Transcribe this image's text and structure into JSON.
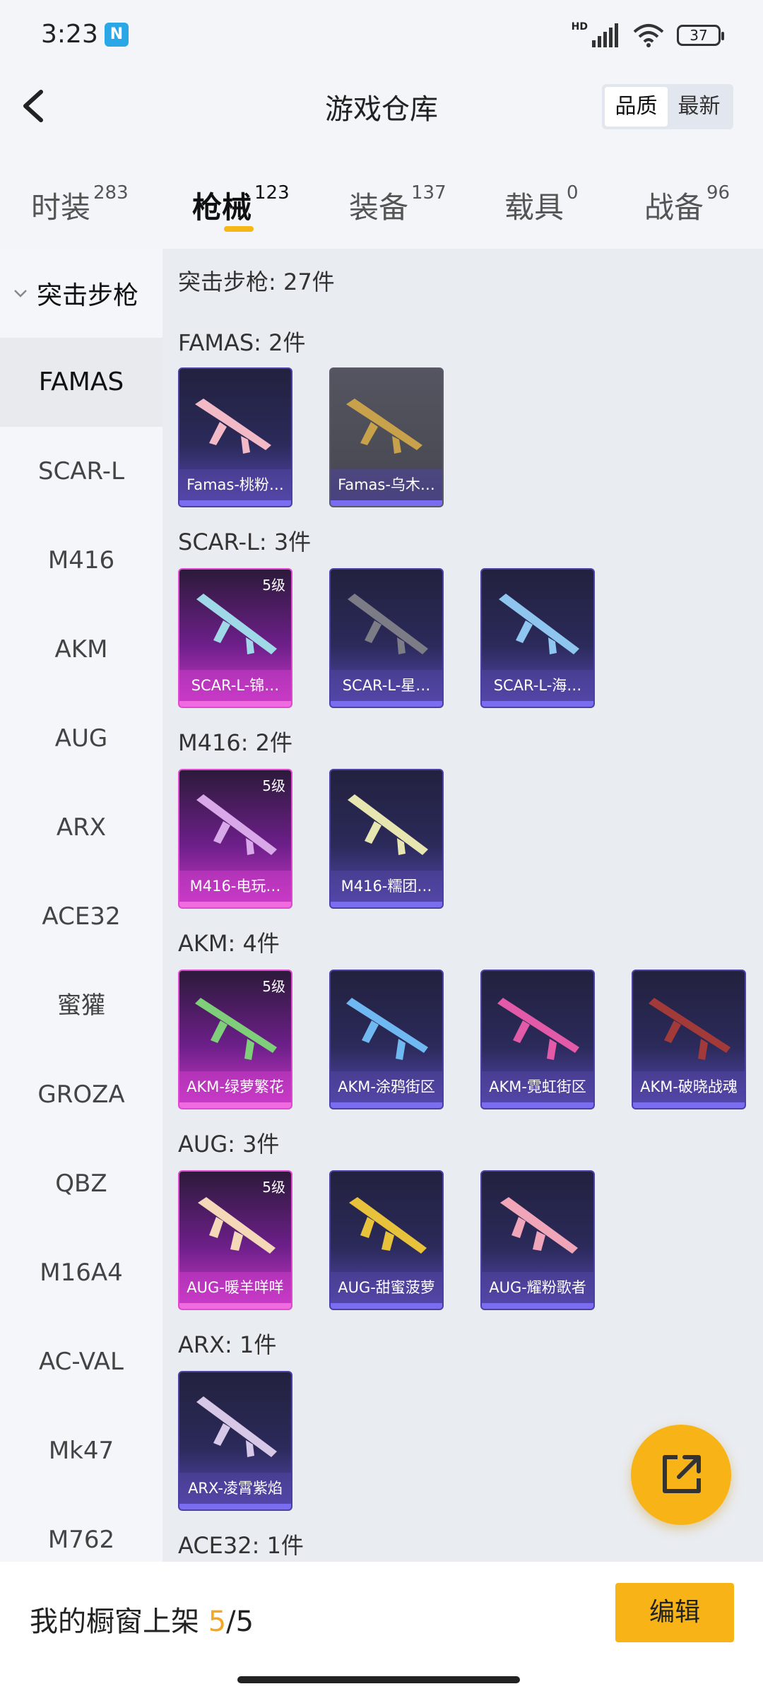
{
  "status": {
    "time": "3:23",
    "battery": "37",
    "hd_label": "HD"
  },
  "header": {
    "title": "游戏仓库",
    "sort_options": [
      "品质",
      "最新"
    ],
    "sort_active": "品质"
  },
  "tabs": [
    {
      "label": "时装",
      "count": "283"
    },
    {
      "label": "枪械",
      "count": "123"
    },
    {
      "label": "装备",
      "count": "137"
    },
    {
      "label": "载具",
      "count": "0"
    },
    {
      "label": "战备",
      "count": "96"
    }
  ],
  "sidebar": {
    "group": "突击步枪",
    "items": [
      "FAMAS",
      "SCAR-L",
      "M416",
      "AKM",
      "AUG",
      "ARX",
      "ACE32",
      "蜜獾",
      "GROZA",
      "QBZ",
      "M16A4",
      "AC-VAL",
      "Mk47",
      "M762"
    ]
  },
  "content": {
    "summary": "突击步枪: 27件",
    "groups": [
      {
        "title": "FAMAS: 2件",
        "items": [
          {
            "name": "Famas-桃粉…",
            "grade": ""
          },
          {
            "name": "Famas-乌木…",
            "grade": ""
          }
        ]
      },
      {
        "title": "SCAR-L: 3件",
        "items": [
          {
            "name": "SCAR-L-锦…",
            "grade": "5级"
          },
          {
            "name": "SCAR-L-星…",
            "grade": ""
          },
          {
            "name": "SCAR-L-海…",
            "grade": ""
          }
        ]
      },
      {
        "title": "M416: 2件",
        "items": [
          {
            "name": "M416-电玩…",
            "grade": "5级"
          },
          {
            "name": "M416-糯团…",
            "grade": ""
          }
        ]
      },
      {
        "title": "AKM: 4件",
        "items": [
          {
            "name": "AKM-绿萝繁花",
            "grade": "5级"
          },
          {
            "name": "AKM-涂鸦街区",
            "grade": ""
          },
          {
            "name": "AKM-霓虹街区",
            "grade": ""
          },
          {
            "name": "AKM-破晓战魂",
            "grade": ""
          }
        ]
      },
      {
        "title": "AUG: 3件",
        "items": [
          {
            "name": "AUG-暖羊咩咩",
            "grade": "5级"
          },
          {
            "name": "AUG-甜蜜菠萝",
            "grade": ""
          },
          {
            "name": "AUG-耀粉歌者",
            "grade": ""
          }
        ]
      },
      {
        "title": "ARX: 1件",
        "items": [
          {
            "name": "ARX-凌霄紫焰",
            "grade": ""
          }
        ]
      },
      {
        "title": "ACE32: 1件",
        "items": []
      }
    ]
  },
  "bottom": {
    "shop_label": "我的橱窗上架",
    "shop_current": "5",
    "shop_sep": "/",
    "shop_total": "5",
    "edit_label": "编辑"
  },
  "colors": {
    "accent": "#f8b417",
    "grade5": "#d03ac8",
    "normal": "#4b3fa8"
  }
}
